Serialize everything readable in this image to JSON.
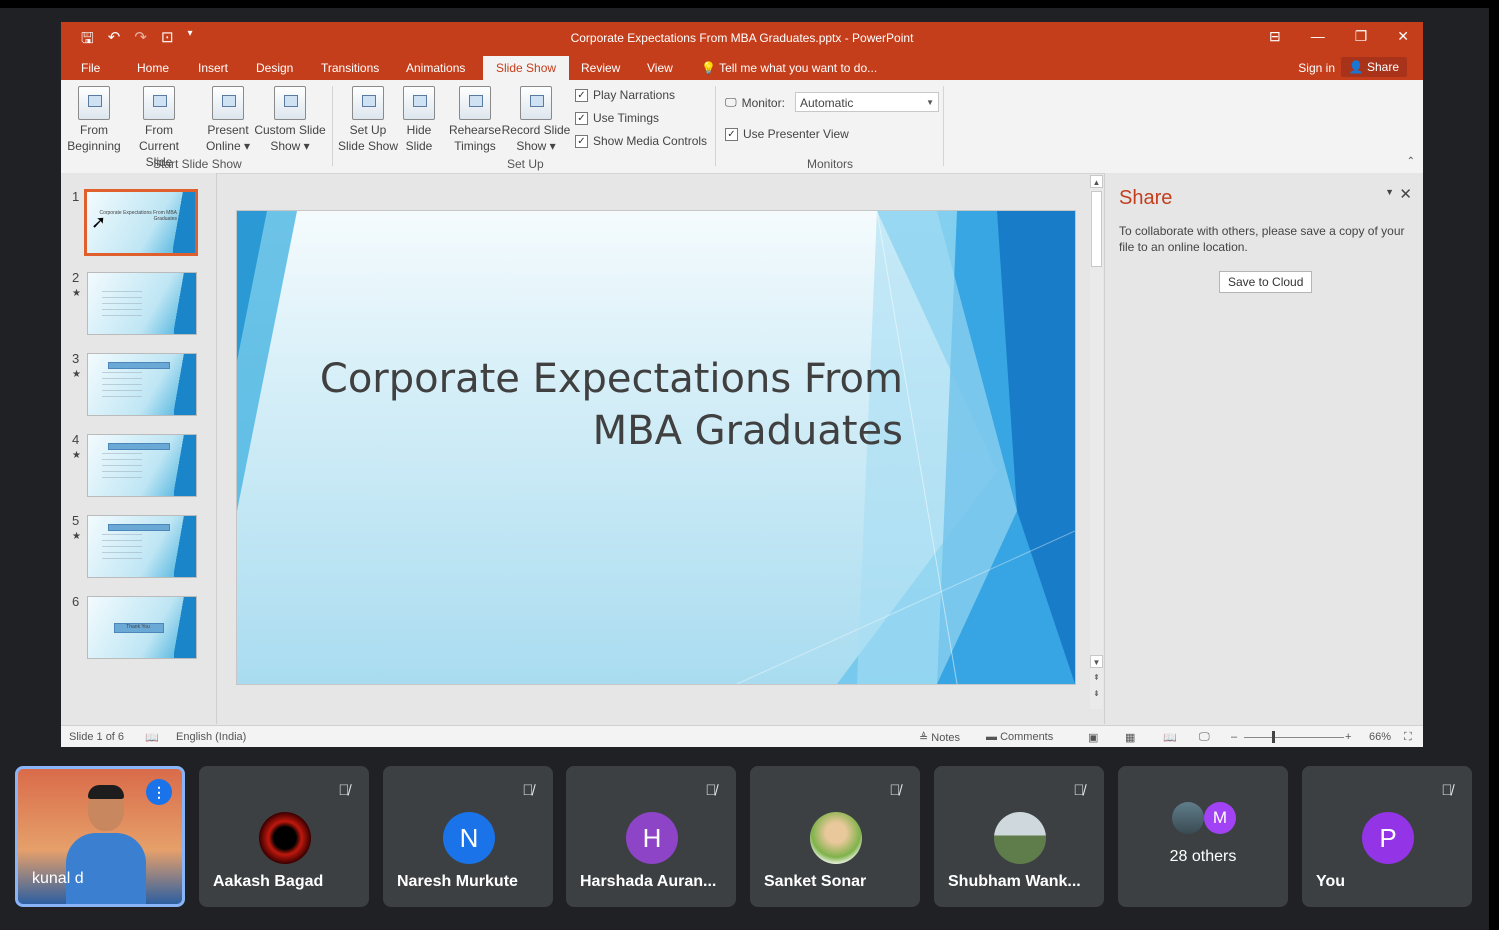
{
  "ppt": {
    "title": "Corporate Expectations From MBA Graduates.pptx - PowerPoint",
    "qat_icons": [
      "save-icon",
      "undo-icon",
      "redo-icon",
      "present-icon",
      "customize-icon"
    ],
    "tabs": [
      "File",
      "Home",
      "Insert",
      "Design",
      "Transitions",
      "Animations",
      "Slide Show",
      "Review",
      "View"
    ],
    "active_tab": "Slide Show",
    "tell_me": "Tell me what you want to do...",
    "sign_in": "Sign in",
    "share": "Share",
    "ribbon": {
      "from_beginning": [
        "From",
        "Beginning"
      ],
      "from_current": [
        "From",
        "Current Slide"
      ],
      "present_online": [
        "Present",
        "Online ▾"
      ],
      "custom_show": [
        "Custom Slide",
        "Show ▾"
      ],
      "start_group": "Start Slide Show",
      "setup_show": [
        "Set Up",
        "Slide Show"
      ],
      "hide_slide": [
        "Hide",
        "Slide"
      ],
      "rehearse": [
        "Rehearse",
        "Timings"
      ],
      "record": [
        "Record Slide",
        "Show ▾"
      ],
      "play_narrations": "Play Narrations",
      "use_timings": "Use Timings",
      "show_media": "Show Media Controls",
      "setup_group": "Set Up",
      "monitor_label": "Monitor:",
      "monitor_value": "Automatic",
      "presenter_view": "Use Presenter View",
      "monitors_group": "Monitors"
    },
    "thumbnails": [
      {
        "num": "1",
        "star": "",
        "title": "Corporate Expectations From MBA Graduates"
      },
      {
        "num": "2",
        "star": "★",
        "title": ""
      },
      {
        "num": "3",
        "star": "★",
        "title": ""
      },
      {
        "num": "4",
        "star": "★",
        "title": ""
      },
      {
        "num": "5",
        "star": "★",
        "title": ""
      },
      {
        "num": "6",
        "star": "",
        "title": "Thank You"
      }
    ],
    "slide": {
      "title_line1": "Corporate Expectations From",
      "title_line2": "MBA Graduates"
    },
    "share_pane": {
      "title": "Share",
      "text": "To collaborate with others, please save a copy of your file to an online location.",
      "button": "Save to Cloud"
    },
    "status": {
      "slide": "Slide 1 of 6",
      "language": "English (India)",
      "notes": "Notes",
      "comments": "Comments",
      "zoom": "66%"
    }
  },
  "meet": {
    "participants": [
      {
        "name": "kunal d",
        "initial": ""
      },
      {
        "name": "Aakash Bagad",
        "initial": ""
      },
      {
        "name": "Naresh Murkute",
        "initial": "N",
        "color": "#1a73e8"
      },
      {
        "name": "Harshada Auran...",
        "initial": "H",
        "color": "#8e44c6"
      },
      {
        "name": "Sanket Sonar",
        "initial": ""
      },
      {
        "name": "Shubham Wank...",
        "initial": ""
      },
      {
        "name": "28 others",
        "initial": "M",
        "color": "#a142f4"
      },
      {
        "name": "You",
        "initial": "P",
        "color": "#9334e6"
      }
    ]
  }
}
